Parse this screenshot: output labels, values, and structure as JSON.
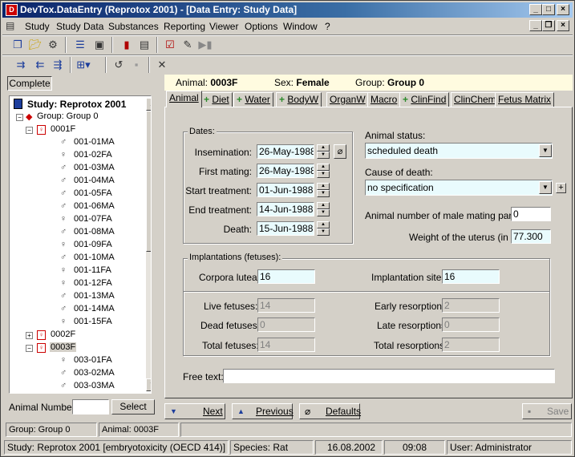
{
  "window": {
    "title": "DevTox.DataEntry (Reprotox 2001) - [Data Entry: Study Data]",
    "app_icon": "devtox-app-icon",
    "controls": [
      "_",
      "□",
      "×"
    ],
    "mdi_controls": [
      "_",
      "❐",
      "×"
    ]
  },
  "menu": [
    "Study",
    "Study Data",
    "Substances",
    "Reporting",
    "Viewer",
    "Options",
    "Window",
    "?"
  ],
  "left": {
    "complete_label": "Complete",
    "tree": {
      "study": "Study: Reprotox 2001",
      "group": "Group: Group 0",
      "animals": [
        {
          "id": "0001F",
          "expanded": true,
          "children": [
            {
              "g": "♂",
              "id": "001-01MA"
            },
            {
              "g": "♀",
              "id": "001-02FA"
            },
            {
              "g": "♂",
              "id": "001-03MA"
            },
            {
              "g": "♂",
              "id": "001-04MA"
            },
            {
              "g": "♂",
              "id": "001-05FA"
            },
            {
              "g": "♂",
              "id": "001-06MA"
            },
            {
              "g": "♀",
              "id": "001-07FA"
            },
            {
              "g": "♂",
              "id": "001-08MA"
            },
            {
              "g": "♀",
              "id": "001-09FA"
            },
            {
              "g": "♂",
              "id": "001-10MA"
            },
            {
              "g": "♀",
              "id": "001-11FA"
            },
            {
              "g": "♀",
              "id": "001-12FA"
            },
            {
              "g": "♂",
              "id": "001-13MA"
            },
            {
              "g": "♂",
              "id": "001-14MA"
            },
            {
              "g": "♀",
              "id": "001-15FA"
            }
          ]
        },
        {
          "id": "0002F",
          "expanded": false,
          "children": []
        },
        {
          "id": "0003F",
          "expanded": true,
          "children": [
            {
              "g": "♀",
              "id": "003-01FA"
            },
            {
              "g": "♂",
              "id": "003-02MA"
            },
            {
              "g": "♂",
              "id": "003-03MA"
            }
          ]
        }
      ]
    },
    "animal_number_label": "Animal Number:",
    "animal_number_value": "",
    "select_label": "Select"
  },
  "info": {
    "animal_label": "Animal:",
    "animal": "0003F",
    "sex_label": "Sex:",
    "sex": "Female",
    "group_label": "Group:",
    "group": "Group 0"
  },
  "tabs": [
    {
      "label": "Animal",
      "plus": false,
      "active": true
    },
    {
      "label": "Diet",
      "plus": true
    },
    {
      "label": "Water",
      "plus": true
    },
    {
      "label": "BodyW",
      "plus": true
    },
    {
      "label": "OrganW",
      "plus": false
    },
    {
      "label": "Macro",
      "plus": false
    },
    {
      "label": "ClinFind",
      "plus": true
    },
    {
      "label": "ClinChem",
      "plus": false
    },
    {
      "label": "Fetus Matrix",
      "plus": false
    }
  ],
  "dates": {
    "group_label": "Dates:",
    "rows": [
      {
        "label": "Insemination:",
        "value": "26-May-1988"
      },
      {
        "label": "First mating:",
        "value": "26-May-1988"
      },
      {
        "label": "Start treatment:",
        "value": "01-Jun-1988"
      },
      {
        "label": "End treatment:",
        "value": "14-Jun-1988"
      },
      {
        "label": "Death:",
        "value": "15-Jun-1988"
      }
    ]
  },
  "status": {
    "animal_status_label": "Animal status:",
    "animal_status": "scheduled death",
    "cause_label": "Cause of death:",
    "cause": "no specification",
    "male_partner_label": "Animal number of male mating partner:",
    "male_partner": "0",
    "uterus_label": "Weight of the uterus (in g):",
    "uterus": "77.300"
  },
  "implantations": {
    "group_label": "Implantations (fetuses):",
    "corpora_label": "Corpora lutea:",
    "corpora": "16",
    "sites_label": "Implantation sites:",
    "sites": "16",
    "live_label": "Live fetuses:",
    "live": "14",
    "dead_label": "Dead fetuses:",
    "dead": "0",
    "total_label": "Total fetuses:",
    "total": "14",
    "early_label": "Early resorptions:",
    "early": "2",
    "late_label": "Late resorptions:",
    "late": "0",
    "total_res_label": "Total resorptions:",
    "total_res": "2"
  },
  "free_text_label": "Free text:",
  "free_text": "",
  "nav": {
    "next": "Next",
    "previous": "Previous",
    "defaults": "Defaults",
    "save": "Save"
  },
  "statusbar1": {
    "group": "Group: Group 0",
    "animal": "Animal: 0003F"
  },
  "statusbar2": {
    "study": "Study: Reprotox 2001 [embryotoxicity (OECD 414)]",
    "species": "Species: Rat",
    "date": "16.08.2002",
    "time": "09:08",
    "user": "User: Administrator"
  }
}
